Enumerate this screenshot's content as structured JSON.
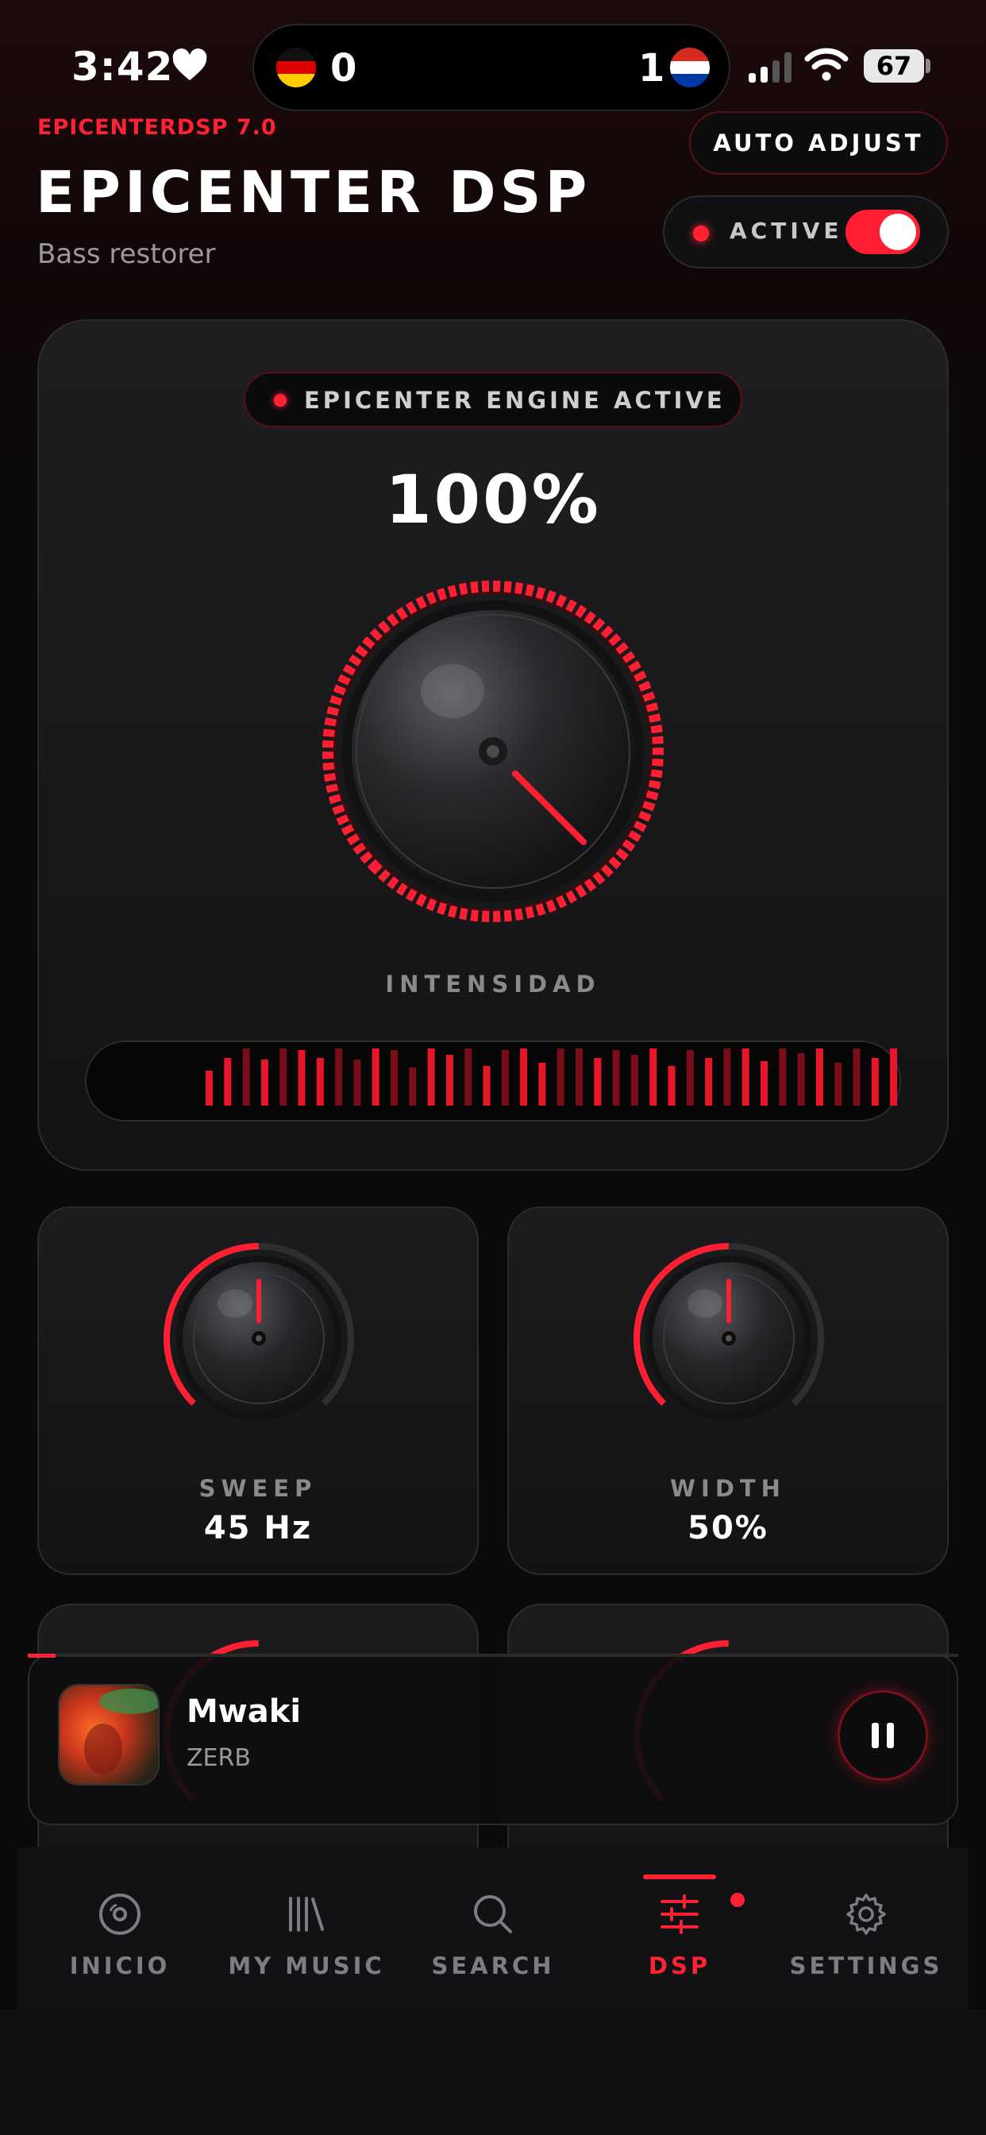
{
  "status_bar": {
    "time": "3:42",
    "score_left": "0",
    "score_right": "1",
    "battery": "67"
  },
  "header": {
    "version": "EPICENTERDSP 7.0",
    "title": "EPICENTER DSP",
    "subtitle": "Bass restorer",
    "auto_adjust_label": "AUTO ADJUST",
    "active_label": "ACTIVE",
    "active_on": true
  },
  "main_knob": {
    "badge": "EPICENTER ENGINE ACTIVE",
    "value": "100%",
    "level": 1.0,
    "label": "INTENSIDAD"
  },
  "knobs": [
    {
      "label": "SWEEP",
      "value": "45 Hz"
    },
    {
      "label": "WIDTH",
      "value": "50%"
    }
  ],
  "now_playing": {
    "title": "Mwaki",
    "artist": "ZERB",
    "progress": 0.03
  },
  "nav": {
    "items": [
      {
        "label": "INICIO",
        "icon": "disc-icon"
      },
      {
        "label": "MY MUSIC",
        "icon": "library-icon"
      },
      {
        "label": "SEARCH",
        "icon": "search-icon"
      },
      {
        "label": "DSP",
        "icon": "sliders-icon"
      },
      {
        "label": "SETTINGS",
        "icon": "gear-icon"
      }
    ],
    "active": "DSP"
  },
  "colors": {
    "accent": "#ff2233",
    "background": "#0a0a0b",
    "card": "#1a1a1c"
  }
}
